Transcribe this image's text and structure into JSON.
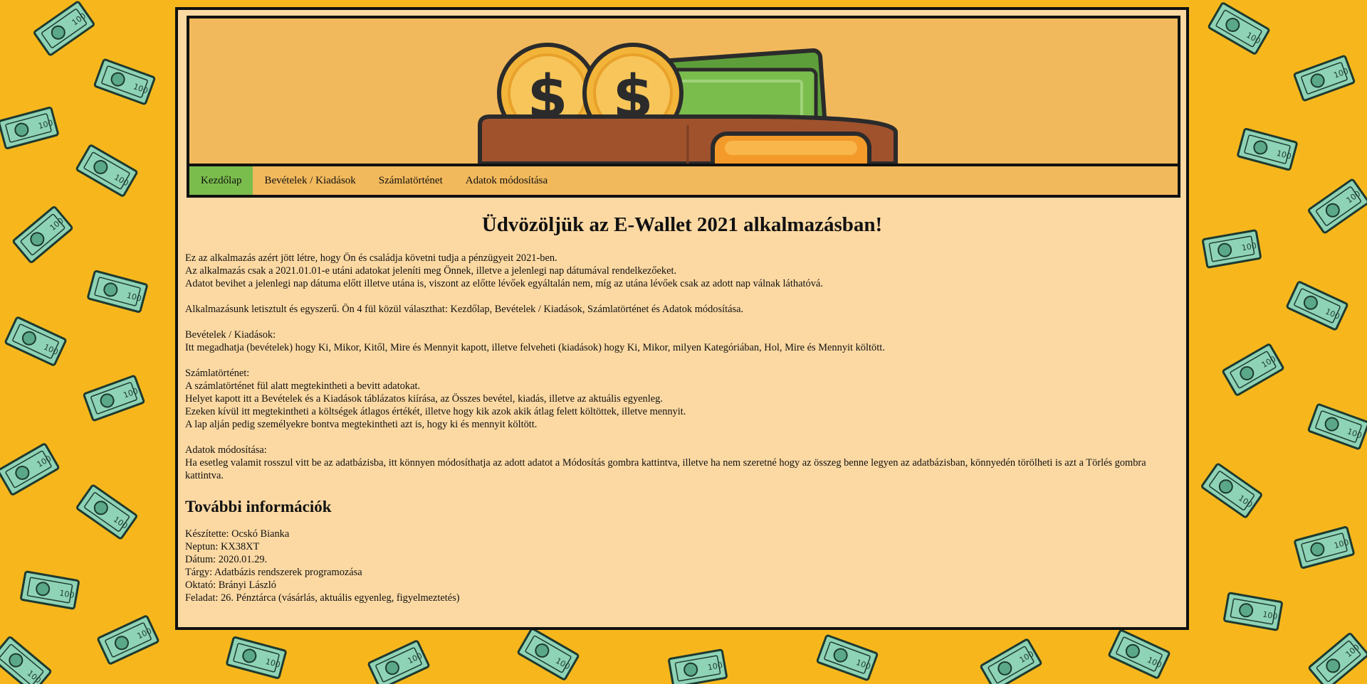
{
  "colors": {
    "page_background": "#f7b71c",
    "content_background": "#fcd9a3",
    "header_background": "#f2b95c",
    "nav_active": "#7bbd4d",
    "border": "#111111",
    "banknote": "#8fd3b6",
    "wallet_brown": "#a0522d",
    "coin_gold": "#f3b43a",
    "cash_green": "#7bbd4d"
  },
  "background_icon": "banknote-pattern",
  "banner_icon": "wallet-with-coins-and-cash-icon",
  "nav": {
    "items": [
      {
        "label": "Kezdőlap",
        "active": true
      },
      {
        "label": "Bevételek / Kiadások",
        "active": false
      },
      {
        "label": "Számlatörténet",
        "active": false
      },
      {
        "label": "Adatok módosítása",
        "active": false
      }
    ]
  },
  "main": {
    "title": "Üdvözöljük az E-Wallet 2021 alkalmazásban!",
    "intro": [
      "Ez az alkalmazás azért jött létre, hogy Ön és családja követni tudja a pénzügyeit 2021-ben.",
      "Az alkalmazás csak a 2021.01.01-e utáni adatokat jeleníti meg Önnek, illetve a jelenlegi nap dátumával rendelkezőeket.",
      "Adatot bevihet a jelenlegi nap dátuma előtt illetve utána is, viszont az előtte lévőek egyáltalán nem, míg az utána lévőek csak az adott nap válnak láthatóvá."
    ],
    "tabs_overview": "Alkalmazásunk letisztult és egyszerű. Ön 4 fül közül választhat: Kezdőlap, Bevételek / Kiadások, Számlatörténet és Adatok módosítása.",
    "income_section": {
      "heading": "Bevételek / Kiadások:",
      "lines": [
        "Itt megadhatja (bevételek) hogy Ki, Mikor, Kitől, Mire és Mennyit kapott, illetve felveheti (kiadások) hogy Ki, Mikor, milyen Kategóriában, Hol, Mire és Mennyit költött."
      ]
    },
    "history_section": {
      "heading": "Számlatörténet:",
      "lines": [
        "A számlatörténet fül alatt megtekintheti a bevitt adatokat.",
        "Helyet kapott itt a Bevételek és a Kiadások táblázatos kiírása, az Összes bevétel, kiadás, illetve az aktuális egyenleg.",
        "Ezeken kívül itt megtekintheti a költségek átlagos értékét, illetve hogy kik azok akik átlag felett költöttek, illetve mennyit.",
        "A lap alján pedig személyekre bontva megtekintheti azt is, hogy ki és mennyit költött."
      ]
    },
    "edit_section": {
      "heading": "Adatok módosítása:",
      "lines": [
        "Ha esetleg valamit rosszul vitt be az adatbázisba, itt könnyen módosíthatja az adott adatot a Módosítás gombra kattintva, illetve ha nem szeretné hogy az összeg benne legyen az adatbázisban, könnyedén törölheti is azt a Törlés gombra kattintva."
      ]
    },
    "more_info": {
      "title": "További információk",
      "lines": [
        "Készítette: Ocskó Bianka",
        "Neptun: KX38XT",
        "Dátum: 2020.01.29.",
        "Tárgy: Adatbázis rendszerek programozása",
        "Oktató: Brányi László",
        "Feladat: 26. Pénztárca (vásárlás, aktuális egyenleg, figyelmeztetés)"
      ]
    }
  }
}
